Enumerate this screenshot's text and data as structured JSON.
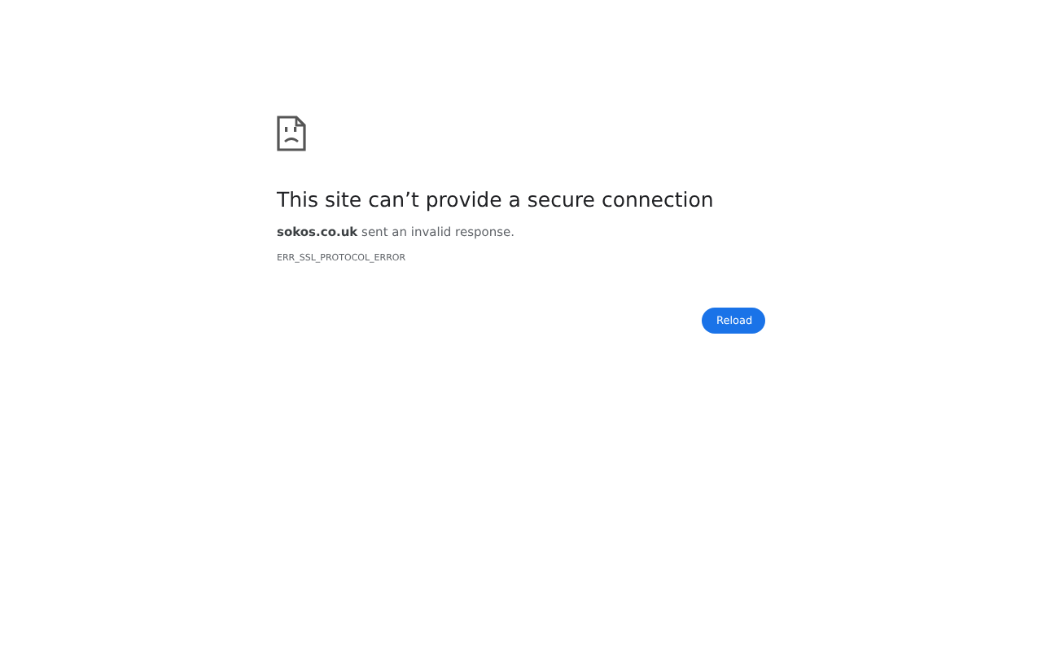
{
  "error": {
    "title": "This site can’t provide a secure connection",
    "message": "**sokos.co.uk** sent an invalid response.",
    "code": "ERR_SSL_PROTOCOL_ERROR"
  },
  "buttons": [
    "Reload"
  ]
}
